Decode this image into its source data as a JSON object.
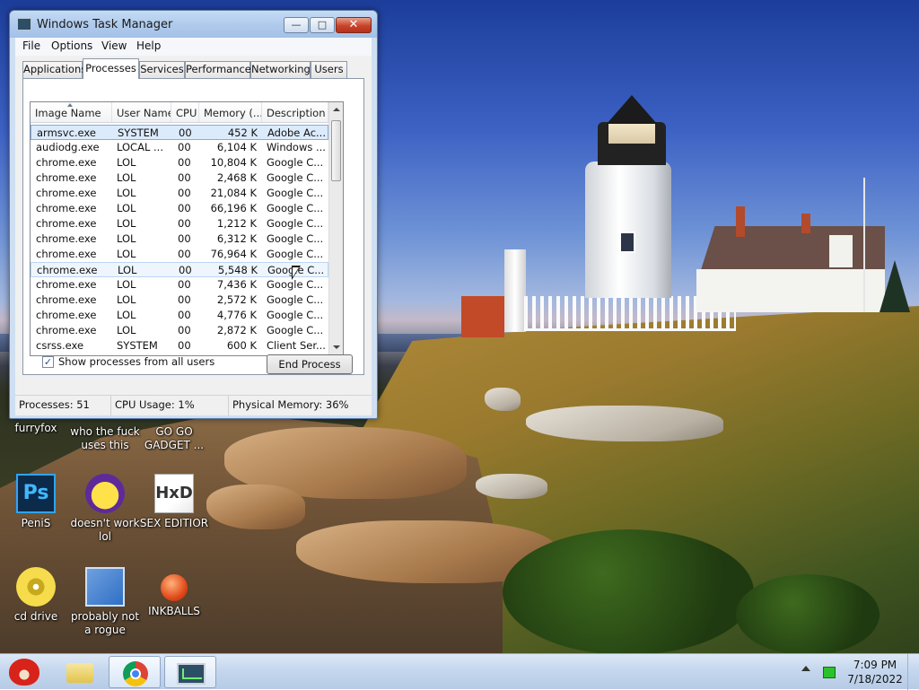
{
  "window": {
    "title": "Windows Task Manager",
    "controls": {
      "minimize": "—",
      "maximize": "□",
      "close": "✕"
    },
    "menu": [
      "File",
      "Options",
      "View",
      "Help"
    ],
    "tabs": [
      "Applications",
      "Processes",
      "Services",
      "Performance",
      "Networking",
      "Users"
    ],
    "active_tab": "Processes",
    "columns": [
      "Image Name",
      "User Name",
      "CPU",
      "Memory (...",
      "Description"
    ],
    "rows": [
      {
        "name": "armsvc.exe",
        "user": "SYSTEM",
        "cpu": "00",
        "mem": "452 K",
        "desc": "Adobe Ac..."
      },
      {
        "name": "audiodg.exe",
        "user": "LOCAL ...",
        "cpu": "00",
        "mem": "6,104 K",
        "desc": "Windows ..."
      },
      {
        "name": "chrome.exe",
        "user": "LOL",
        "cpu": "00",
        "mem": "10,804 K",
        "desc": "Google C..."
      },
      {
        "name": "chrome.exe",
        "user": "LOL",
        "cpu": "00",
        "mem": "2,468 K",
        "desc": "Google C..."
      },
      {
        "name": "chrome.exe",
        "user": "LOL",
        "cpu": "00",
        "mem": "21,084 K",
        "desc": "Google C..."
      },
      {
        "name": "chrome.exe",
        "user": "LOL",
        "cpu": "00",
        "mem": "66,196 K",
        "desc": "Google C..."
      },
      {
        "name": "chrome.exe",
        "user": "LOL",
        "cpu": "00",
        "mem": "1,212 K",
        "desc": "Google C..."
      },
      {
        "name": "chrome.exe",
        "user": "LOL",
        "cpu": "00",
        "mem": "6,312 K",
        "desc": "Google C..."
      },
      {
        "name": "chrome.exe",
        "user": "LOL",
        "cpu": "00",
        "mem": "76,964 K",
        "desc": "Google C..."
      },
      {
        "name": "chrome.exe",
        "user": "LOL",
        "cpu": "00",
        "mem": "5,548 K",
        "desc": "Google C..."
      },
      {
        "name": "chrome.exe",
        "user": "LOL",
        "cpu": "00",
        "mem": "7,436 K",
        "desc": "Google C..."
      },
      {
        "name": "chrome.exe",
        "user": "LOL",
        "cpu": "00",
        "mem": "2,572 K",
        "desc": "Google C..."
      },
      {
        "name": "chrome.exe",
        "user": "LOL",
        "cpu": "00",
        "mem": "4,776 K",
        "desc": "Google C..."
      },
      {
        "name": "chrome.exe",
        "user": "LOL",
        "cpu": "00",
        "mem": "2,872 K",
        "desc": "Google C..."
      },
      {
        "name": "csrss.exe",
        "user": "SYSTEM",
        "cpu": "00",
        "mem": "600 K",
        "desc": "Client Ser..."
      }
    ],
    "show_all_label": "Show processes from all users",
    "show_all_checked": true,
    "end_process_label": "End Process",
    "status": {
      "processes": "Processes: 51",
      "cpu": "CPU Usage: 1%",
      "memory": "Physical Memory: 36%"
    }
  },
  "desktop_icons": [
    {
      "label": "furryfox",
      "icon": "firefox-icon"
    },
    {
      "label": "who the fuck uses this",
      "icon": "app-icon"
    },
    {
      "label": "GO GO GADGET ...",
      "icon": "gadget-icon"
    },
    {
      "label": "PeniS",
      "icon": "photoshop-icon",
      "glyph": "Ps"
    },
    {
      "label": "doesn't work lol",
      "icon": "yahoo-messenger-icon"
    },
    {
      "label": "SEX EDITIOR",
      "icon": "hxd-editor-icon",
      "glyph": "HxD"
    },
    {
      "label": "cd drive",
      "icon": "cd-drive-icon"
    },
    {
      "label": "probably not a rogue",
      "icon": "control-panel-icon"
    },
    {
      "label": "INKBALLS",
      "icon": "inkball-icon"
    }
  ],
  "taskbar": {
    "start_icon": "angry-birds-start-icon",
    "pinned": [
      "explorer-folder-icon",
      "chrome-icon",
      "task-manager-icon"
    ],
    "clock_time": "7:09 PM",
    "clock_date": "7/18/2022"
  },
  "colors": {
    "selection": "#dcebfc",
    "close_button": "#c8432a",
    "taskbar": "#c5d7ee"
  }
}
